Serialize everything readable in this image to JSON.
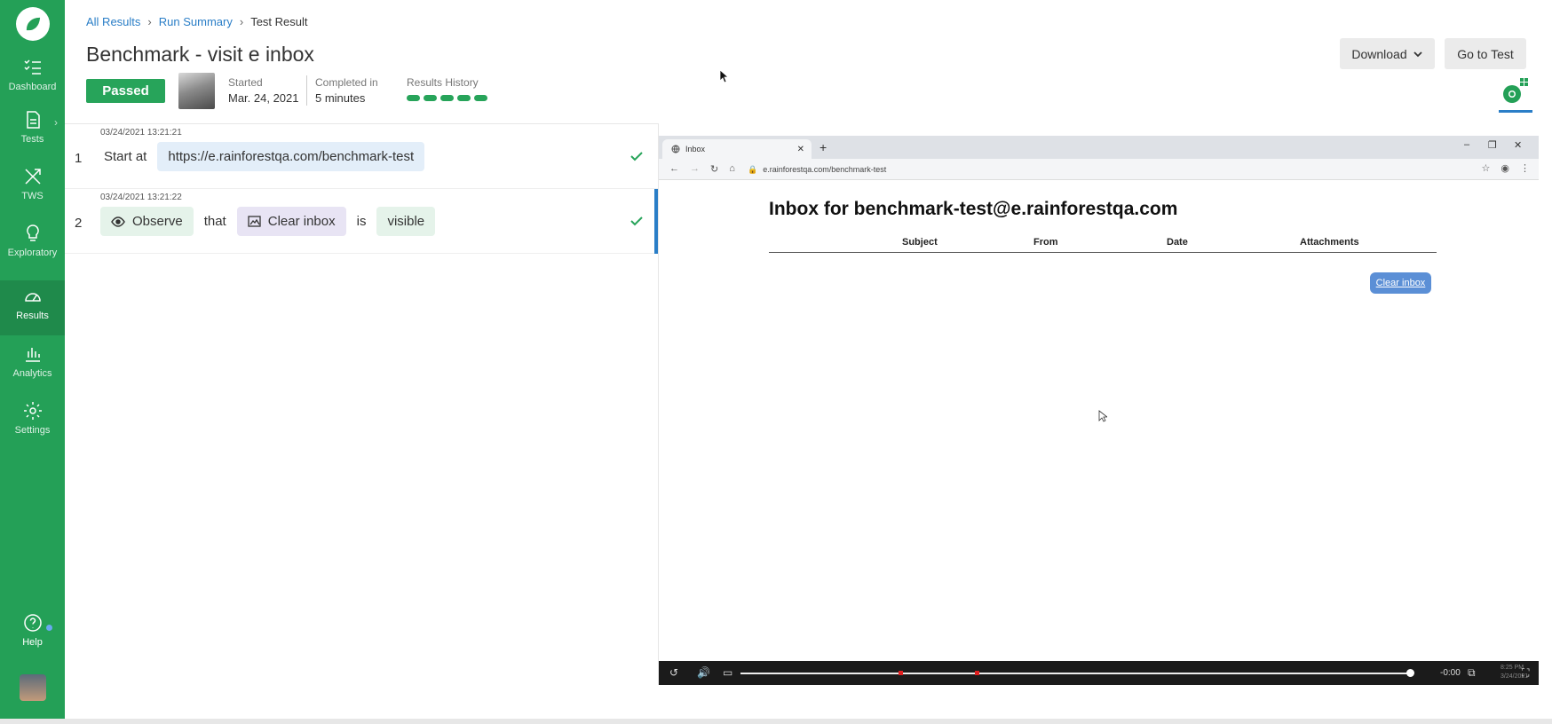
{
  "sidebar": {
    "items": [
      {
        "label": "Dashboard",
        "icon": "checklist-icon"
      },
      {
        "label": "Tests",
        "icon": "document-icon"
      },
      {
        "label": "TWS",
        "icon": "tools-icon"
      },
      {
        "label": "Exploratory",
        "icon": "lightbulb-icon"
      },
      {
        "label": "Results",
        "icon": "gauge-icon"
      },
      {
        "label": "Analytics",
        "icon": "bar-chart-icon"
      },
      {
        "label": "Settings",
        "icon": "gear-icon"
      }
    ],
    "help_label": "Help",
    "accent": "#24a057"
  },
  "breadcrumb": {
    "items": [
      "All Results",
      "Run Summary",
      "Test Result"
    ],
    "separator": "›"
  },
  "header": {
    "title": "Benchmark - visit e inbox",
    "status": "Passed",
    "started_label": "Started",
    "started_value": "Mar. 24, 2021",
    "completed_label": "Completed in",
    "completed_value": "5 minutes",
    "history_label": "Results History",
    "history_runs": 5,
    "download_label": "Download",
    "go_to_test_label": "Go to Test"
  },
  "steps": [
    {
      "timestamp": "03/24/2021 13:21:21",
      "number": "1",
      "prefix": "Start at",
      "url": "https://e.rainforestqa.com/benchmark-test"
    },
    {
      "timestamp": "03/24/2021 13:21:22",
      "number": "2",
      "action": "Observe",
      "that": "that",
      "element": "Clear inbox",
      "is": "is",
      "state": "visible"
    }
  ],
  "browser": {
    "tab_title": "Inbox",
    "url": "e.rainforestqa.com/benchmark-test",
    "page_heading": "Inbox for benchmark-test@e.rainforestqa.com",
    "columns": [
      "Subject",
      "From",
      "Date",
      "Attachments"
    ],
    "clear_button": "Clear inbox"
  },
  "player": {
    "time": "-0:00",
    "clock_time": "8:25 PM",
    "clock_date": "3/24/2021"
  }
}
